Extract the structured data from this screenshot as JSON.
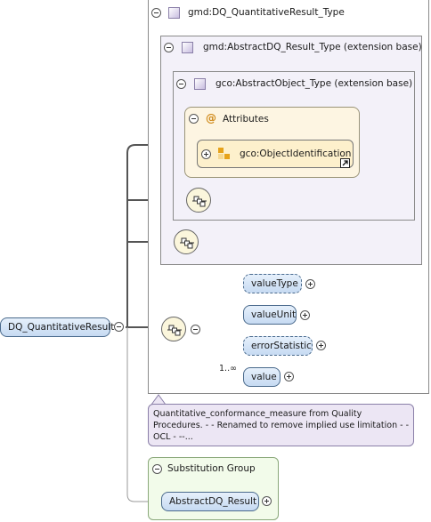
{
  "root": {
    "element_name": "DQ_QuantitativeResult"
  },
  "types": {
    "outer_type": "gmd:DQ_QuantitativeResult_Type",
    "middle_type": "gmd:AbstractDQ_Result_Type (extension base)",
    "inner_type": "gco:AbstractObject_Type (extension base)"
  },
  "attributes": {
    "label": "Attributes",
    "attribute_group": "gco:ObjectIdentification"
  },
  "sequence_children": [
    {
      "name": "valueType",
      "optional": true,
      "multiplicity": ""
    },
    {
      "name": "valueUnit",
      "optional": false,
      "multiplicity": ""
    },
    {
      "name": "errorStatistic",
      "optional": true,
      "multiplicity": ""
    },
    {
      "name": "value",
      "optional": false,
      "multiplicity": "1..∞"
    }
  ],
  "annotation": {
    "text": "Quantitative_conformance_measure from Quality Procedures. - - Renamed to remove implied use limitation - - OCL - --..."
  },
  "substitution": {
    "label": "Substitution Group",
    "element_name": "AbstractDQ_Result"
  },
  "colors": {
    "type_fill": "#f3f1f9",
    "type_border": "#8a8a8a",
    "attributes_fill": "#fdf5e2",
    "attributes_border": "#9a9478",
    "annotation_fill": "#ece6f4",
    "substitution_fill": "#f2fbea",
    "element_border": "#4a6a8c"
  },
  "icons": {
    "attributes_icon": "at-sign-icon",
    "attribute_group_icon": "attribute-group-icon",
    "sequence_icon": "sequence-compositor-icon",
    "type_icon": "complex-type-icon"
  }
}
